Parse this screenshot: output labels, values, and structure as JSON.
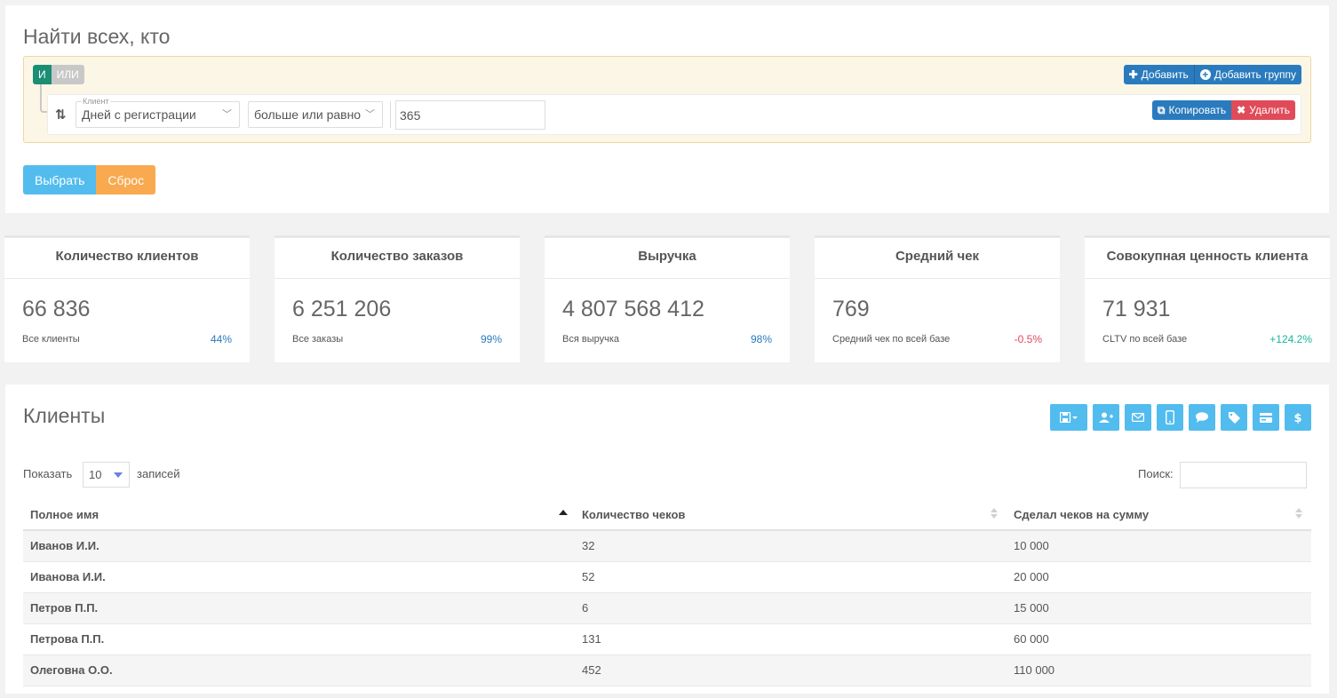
{
  "filter": {
    "title": "Найти всех, кто",
    "and_label": "И",
    "or_label": "ИЛИ",
    "add_label": "Добавить",
    "add_group_label": "Добавить группу",
    "rule": {
      "field_legend": "Клиент",
      "field_value": "Дней с регистрации",
      "operator_value": "больше или равно",
      "value": "365",
      "copy_label": "Копировать",
      "delete_label": "Удалить"
    },
    "select_label": "Выбрать",
    "reset_label": "Сброс"
  },
  "stats": [
    {
      "title": "Количество клиентов",
      "value": "66 836",
      "sub": "Все клиенты",
      "pct": "44%",
      "pct_color": "#2a7bbd"
    },
    {
      "title": "Количество заказов",
      "value": "6 251 206",
      "sub": "Все заказы",
      "pct": "99%",
      "pct_color": "#2a7bbd"
    },
    {
      "title": "Выручка",
      "value": "4 807 568 412",
      "sub": "Вся выручка",
      "pct": "98%",
      "pct_color": "#2a7bbd"
    },
    {
      "title": "Средний чек",
      "value": "769",
      "sub": "Средний чек по всей базе",
      "pct": "-0.5%",
      "pct_color": "#e04b5a"
    },
    {
      "title": "Совокупная ценность клиента",
      "value": "71 931",
      "sub": "CLTV по всей базе",
      "pct": "+124.2%",
      "pct_color": "#1bb39a"
    }
  ],
  "clients": {
    "title": "Клиенты",
    "toolbar_icons": [
      "save-icon",
      "add-user-icon",
      "email-icon",
      "mobile-icon",
      "chat-icon",
      "tag-icon",
      "card-icon",
      "dollar-icon"
    ],
    "show_label": "Показать",
    "page_length": "10",
    "records_label": "записей",
    "search_label": "Поиск:",
    "columns": [
      "Полное имя",
      "Количество чеков",
      "Сделал чеков на сумму"
    ],
    "rows": [
      [
        "Иванов И.И.",
        "32",
        "10 000"
      ],
      [
        "Иванова И.И.",
        "52",
        "20 000"
      ],
      [
        "Петров П.П.",
        "6",
        "15 000"
      ],
      [
        "Петрова П.П.",
        "131",
        "60 000"
      ],
      [
        "Олеговна О.О.",
        "452",
        "110 000"
      ]
    ]
  }
}
